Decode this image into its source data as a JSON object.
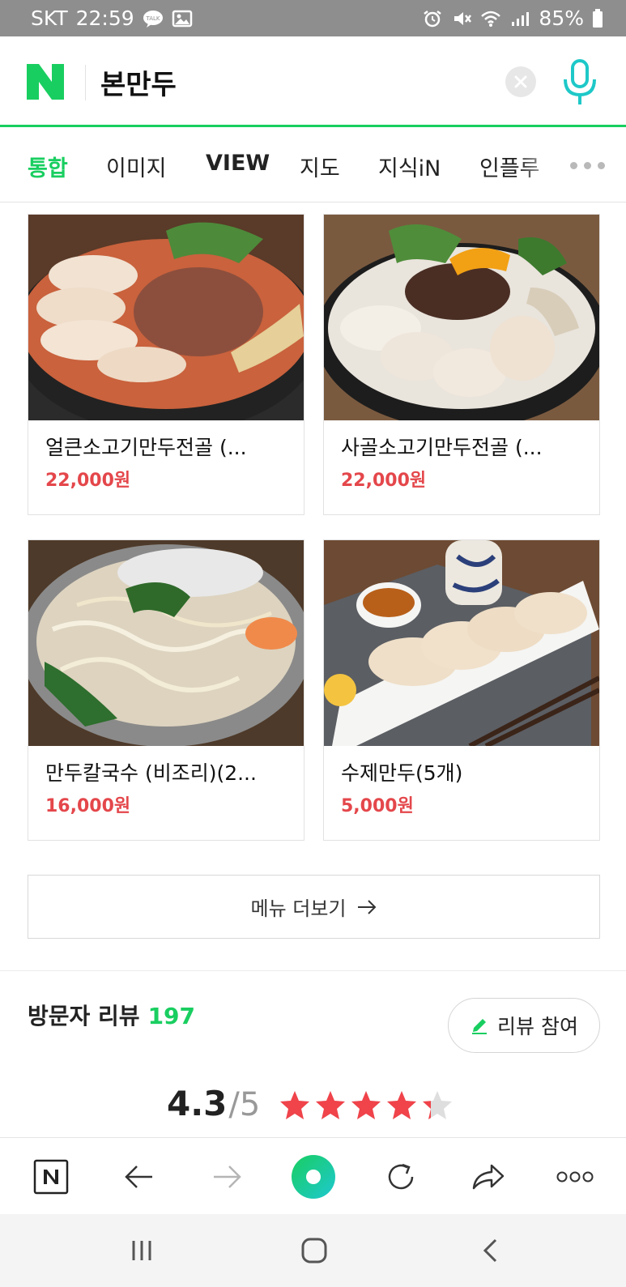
{
  "status_bar": {
    "carrier": "SKT",
    "time": "22:59",
    "battery": "85%",
    "icons": [
      "talk-icon",
      "gallery-icon",
      "alarm-icon",
      "mute-icon",
      "wifi-icon",
      "signal-icon",
      "battery-icon"
    ]
  },
  "search": {
    "query": "본만두",
    "logo": "N"
  },
  "tabs": [
    {
      "label": "통합",
      "active": true
    },
    {
      "label": "이미지"
    },
    {
      "label": "VIEW"
    },
    {
      "label": "지도"
    },
    {
      "label": "지식iN"
    },
    {
      "label": "인플루"
    }
  ],
  "menu_items": [
    {
      "name": "얼큰소고기만두전골 (...",
      "price": "22,000원"
    },
    {
      "name": "사골소고기만두전골 (...",
      "price": "22,000원"
    },
    {
      "name": "만두칼국수 (비조리)(2...",
      "price": "16,000원"
    },
    {
      "name": "수제만두(5개)",
      "price": "5,000원"
    }
  ],
  "more_menu_label": "메뉴 더보기",
  "reviews": {
    "title": "방문자 리뷰",
    "count": "197",
    "button_label": "리뷰 참여",
    "score": "4.3",
    "score_max": "/5",
    "rating_value": 4.3
  },
  "colors": {
    "brand_green": "#19ce60",
    "price_red": "#e4474b",
    "star_red": "#f0434a",
    "star_gray": "#dedede"
  }
}
